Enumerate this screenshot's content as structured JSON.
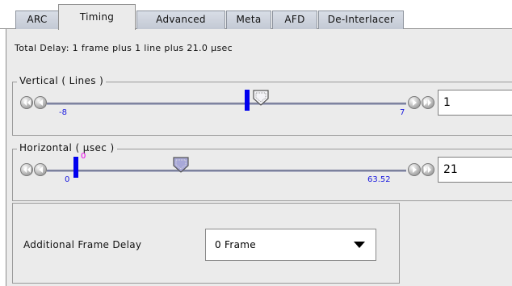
{
  "tabs": [
    {
      "label": "ARC"
    },
    {
      "label": "Timing"
    },
    {
      "label": "Advanced"
    },
    {
      "label": "Meta"
    },
    {
      "label": "AFD"
    },
    {
      "label": "De-Interlacer"
    }
  ],
  "active_tab": "Timing",
  "total_delay": "Total Delay: 1 frame plus 1 line plus 21.0 µsec",
  "vertical": {
    "title": "Vertical ( Lines )",
    "min_label": "-8",
    "max_label": "7",
    "value": "1"
  },
  "horizontal": {
    "title": "Horizontal ( µsec )",
    "marker_label": "0",
    "min_label": "0",
    "max_label": "63.52",
    "value": "21"
  },
  "frame_delay": {
    "label": "Additional Frame Delay",
    "selected": "0 Frame"
  },
  "icons": {
    "first": "double-left-arrow-icon",
    "prev": "left-arrow-icon",
    "next": "right-arrow-icon",
    "last": "double-right-arrow-icon",
    "dropdown": "caret-down-icon"
  },
  "colors": {
    "marker": "#0000ee",
    "tick_label": "#1a1adf",
    "marker_label": "#ee00ee",
    "panel": "#ebebeb"
  }
}
